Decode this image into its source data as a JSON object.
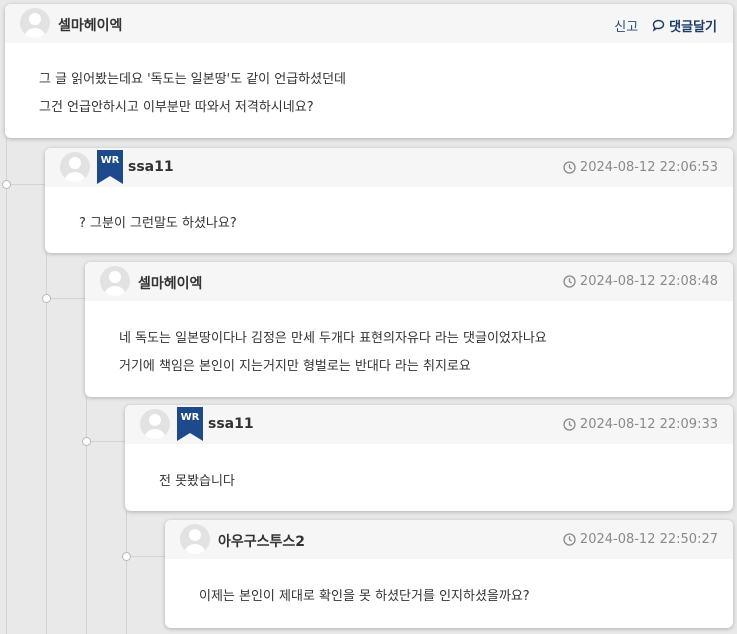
{
  "comments": [
    {
      "author": "셀마헤이엑",
      "actions": {
        "report": "신고",
        "reply": "댓글달기"
      },
      "lines": [
        "그 글 읽어봤는데요 '독도는 일본땅'도 같이 언급하셨던데",
        "그건 언급안하시고 이부분만 따와서 저격하시네요?"
      ]
    },
    {
      "author": "ssa11",
      "writer_badge": "WR",
      "time": "2024-08-12 22:06:53",
      "lines": [
        "? 그분이 그런말도 하셨나요?"
      ]
    },
    {
      "author": "셀마헤이엑",
      "time": "2024-08-12 22:08:48",
      "lines": [
        "네 독도는 일본땅이다나 김정은 만세 두개다 표현의자유다 라는 댓글이었자나요",
        "거기에 책임은 본인이 지는거지만 형벌로는 반대다 라는 취지로요"
      ]
    },
    {
      "author": "ssa11",
      "writer_badge": "WR",
      "time": "2024-08-12 22:09:33",
      "lines": [
        "전 못봤습니다"
      ]
    },
    {
      "author": "아우구스투스2",
      "time": "2024-08-12 22:50:27",
      "lines": [
        "이제는 본인이 제대로 확인을 못 하셨단거를 인지하셨을까요?"
      ]
    }
  ],
  "colors": {
    "badge": "#1c4a8a",
    "link": "#1d3b66",
    "page_bg": "#e9e9e9"
  },
  "icons": {
    "avatar": "person-silhouette-icon",
    "clock": "clock-icon",
    "reply": "speech-bubble-icon",
    "badge": "bookmark-ribbon-icon"
  }
}
